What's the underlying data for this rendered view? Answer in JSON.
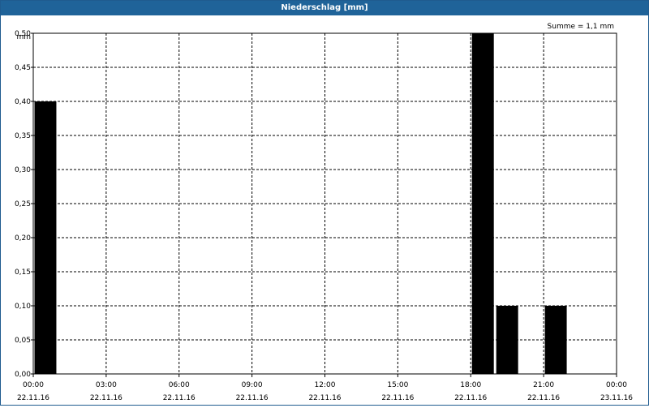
{
  "window": {
    "title": "Niederschlag [mm]"
  },
  "summary_label": "Summe = 1,1 mm",
  "y_unit": "mm",
  "colors": {
    "titlebar": "#1f6399",
    "bar": "#000000",
    "grid": "#000000",
    "background": "#ffffff"
  },
  "chart_data": {
    "type": "bar",
    "title": "Niederschlag [mm]",
    "ylabel": "mm",
    "ylim": [
      0,
      0.5
    ],
    "yticks": [
      "0,00",
      "0,05",
      "0,10",
      "0,15",
      "0,20",
      "0,25",
      "0,30",
      "0,35",
      "0,40",
      "0,45",
      "0,50"
    ],
    "x_range_hours": [
      0,
      24
    ],
    "xticks": [
      {
        "time": "00:00",
        "date": "22.11.16"
      },
      {
        "time": "03:00",
        "date": "22.11.16"
      },
      {
        "time": "06:00",
        "date": "22.11.16"
      },
      {
        "time": "09:00",
        "date": "22.11.16"
      },
      {
        "time": "12:00",
        "date": "22.11.16"
      },
      {
        "time": "15:00",
        "date": "22.11.16"
      },
      {
        "time": "18:00",
        "date": "22.11.16"
      },
      {
        "time": "21:00",
        "date": "22.11.16"
      },
      {
        "time": "00:00",
        "date": "23.11.16"
      }
    ],
    "bars": [
      {
        "start": "00:00",
        "end": "01:00",
        "value": 0.4
      },
      {
        "start": "18:00",
        "end": "19:00",
        "value": 0.5
      },
      {
        "start": "19:00",
        "end": "20:00",
        "value": 0.1
      },
      {
        "start": "21:00",
        "end": "22:00",
        "value": 0.1
      }
    ],
    "grid": true,
    "grid_style": "dashed"
  }
}
